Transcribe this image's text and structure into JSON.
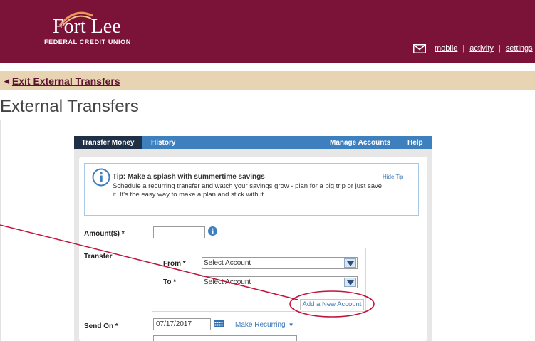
{
  "brand": {
    "name": "Fort Lee",
    "subtitle": "FEDERAL CREDIT UNION",
    "color": "#7b1238"
  },
  "header": {
    "links": [
      "mobile",
      "activity",
      "settings"
    ]
  },
  "breadcrumb": {
    "label": "Exit External Transfers"
  },
  "page": {
    "title": "External Transfers"
  },
  "tabs": {
    "transfer_money": "Transfer Money",
    "history": "History",
    "manage_accounts": "Manage Accounts",
    "help": "Help"
  },
  "tip": {
    "title": "Tip: Make a splash with summertime savings",
    "body": "Schedule a recurring transfer and watch your savings grow - plan for a big trip or just save it. It's the easy way to make a plan and stick with it.",
    "hide_label": "Hide Tip"
  },
  "form": {
    "amount_label": "Amount($) *",
    "amount_value": "",
    "transfer_label": "Transfer",
    "from_label": "From *",
    "from_value": "Select Account",
    "to_label": "To *",
    "to_value": "Select Account",
    "add_account_label": "Add a New Account",
    "send_on_label": "Send On *",
    "send_on_value": "07/17/2017",
    "make_recurring_label": "Make Recurring"
  },
  "colors": {
    "accent": "#3e7fbe",
    "annotation": "#c0143c"
  }
}
